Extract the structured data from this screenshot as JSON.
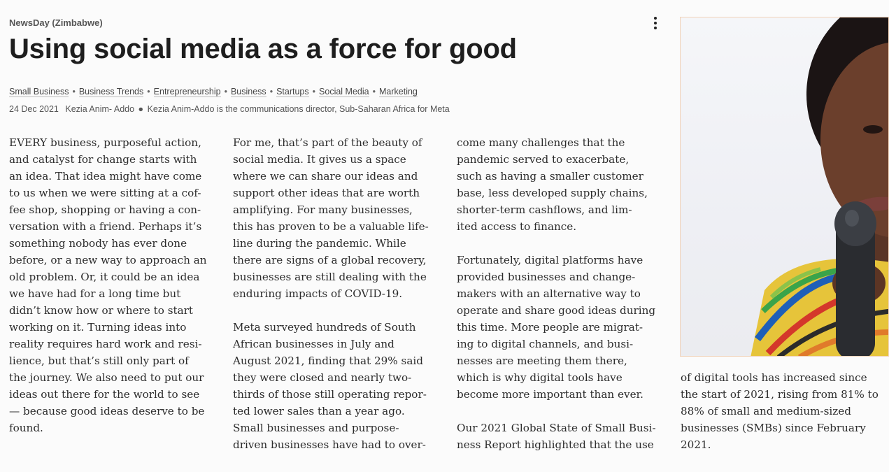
{
  "article": {
    "source": "NewsDay (Zimbabwe)",
    "title": "Using social media as a force for good",
    "tags": [
      "Small Business",
      "Business Trends",
      "Entrepreneurship",
      "Business",
      "Startups",
      "Social Media",
      "Marketing"
    ],
    "date": "24 Dec 2021",
    "author": "Kezia Anim- Addo",
    "byline_separator": "●",
    "author_bio": "Kezia Anim-Addo is the communications director, Sub-Saharan Africa for Meta",
    "columns": [
      [
        "EVERY business, purposeful action,\nand catalyst for change starts with\nan idea. That idea might have come\nto us when we were sitting at a cof-\nfee shop, shopping or having a con-\nversation with a friend. Perhaps it’s\nsomething nobody has ever done\nbefore, or a new way to approach an\nold problem. Or, it could be an idea\nwe have had for a long time but\ndidn’t know how or where to start\nworking on it. Turning ideas into\nreality requires hard work and resi-\nlience, but that’s still only part of\nthe journey. We also need to put our\nideas out there for the world to see\n— because good ideas deserve to be\nfound."
      ],
      [
        "For me, that’s part of the beauty of\nsocial media. It gives us a space\nwhere we can share our ideas and\nsupport other ideas that are worth\namplifying. For many businesses,\nthis has proven to be a valuable life-\nline during the pandemic. While\nthere are signs of a global recovery,\nbusinesses are still dealing with the\nenduring impacts of COVID-19.",
        "Meta surveyed hundreds of South\nAfrican businesses in July and\nAugust 2021, finding that 29% said\nthey were closed and nearly two-\nthirds of those still operating repor-\nted lower sales than a year ago.\nSmall businesses and purpose-\ndriven businesses have had to over-"
      ],
      [
        "come many challenges that the\npandemic served to exacerbate,\nsuch as having a smaller customer\nbase, less developed supply chains,\nshorter-term cashflows, and lim-\nited access to finance.",
        "Fortunately, digital platforms have\nprovided businesses and change-\nmakers with an alternative way to\noperate and share good ideas during\nthis time. More people are migrat-\ning to digital channels, and busi-\nnesses are meeting them there,\nwhich is why digital tools have\nbecome more important than ever.",
        "Our 2021 Global State of Small Busi-\nness Report highlighted that the use"
      ],
      [
        "of digital tools has increased since\nthe start of 2021, rising from 81% to\n88% of small and medium-sized\nbusinesses (SMBs) since February\n2021."
      ]
    ]
  },
  "icons": {
    "menu": "more-vertical-icon"
  },
  "colors": {
    "background": "#fbfbfb",
    "text": "#2a2a2a",
    "photo_border": "#f1d2b8"
  }
}
